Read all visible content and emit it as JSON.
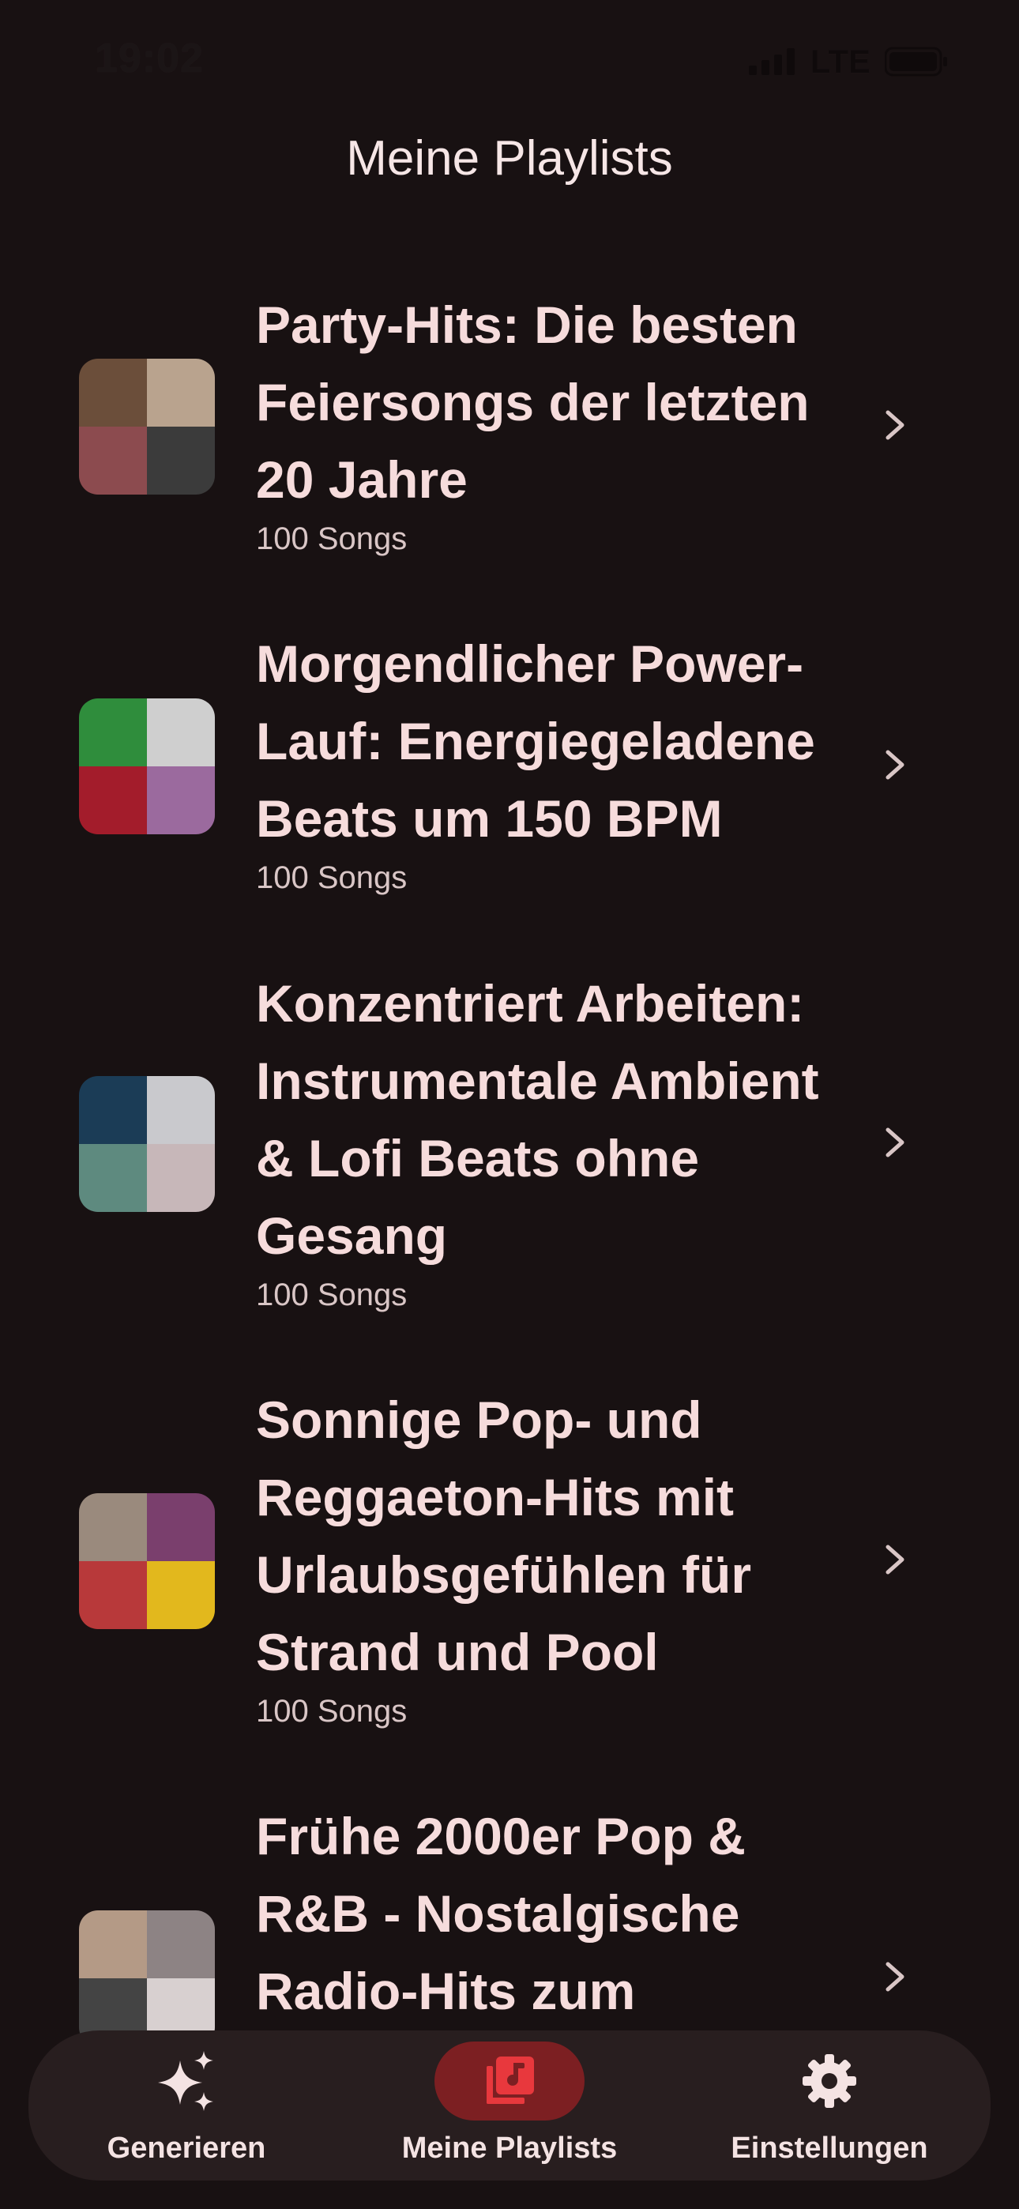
{
  "status_bar": {
    "time": "19:02",
    "network": "LTE"
  },
  "header": {
    "title": "Meine Playlists"
  },
  "playlists": [
    {
      "title": "Party-Hits: Die besten Feiersongs der letzten 20 Jahre",
      "count": "100 Songs",
      "cover_colors": [
        "#6b4e3a",
        "#b9a38e",
        "#8c4b4f",
        "#3b3b3b"
      ]
    },
    {
      "title": "Morgendlicher Power-Lauf: Energiegeladene Beats um 150 BPM",
      "count": "100 Songs",
      "cover_colors": [
        "#2f8d3c",
        "#cfcfcf",
        "#a31c2b",
        "#9b6a9e"
      ]
    },
    {
      "title": "Konzentriert Arbeiten: Instrumentale Ambient & Lofi Beats ohne Gesang",
      "count": "100 Songs",
      "cover_colors": [
        "#1b3c56",
        "#c9c9cd",
        "#5e8a7f",
        "#c7b7b9"
      ]
    },
    {
      "title": "Sonnige Pop- und Reggaeton-Hits mit Urlaubsgefühlen für Strand und Pool",
      "count": "100 Songs",
      "cover_colors": [
        "#9a8a7d",
        "#7a3f6d",
        "#b8393a",
        "#e2b81d"
      ]
    },
    {
      "title": "Frühe 2000er Pop & R&B - Nostalgische Radio-Hits zum",
      "count": "",
      "cover_colors": [
        "#b49a86",
        "#8d8384",
        "#444444",
        "#d8d0d0"
      ]
    }
  ],
  "bottom_nav": {
    "items": [
      {
        "label": "Generieren",
        "icon": "sparkles-icon"
      },
      {
        "label": "Meine Playlists",
        "icon": "music-library-icon",
        "active": true
      },
      {
        "label": "Einstellungen",
        "icon": "gear-icon"
      }
    ]
  },
  "colors": {
    "background": "#181112",
    "nav_background": "#281e1f",
    "active_indicator": "#7c1f22",
    "accent_icon": "#e8383d"
  }
}
